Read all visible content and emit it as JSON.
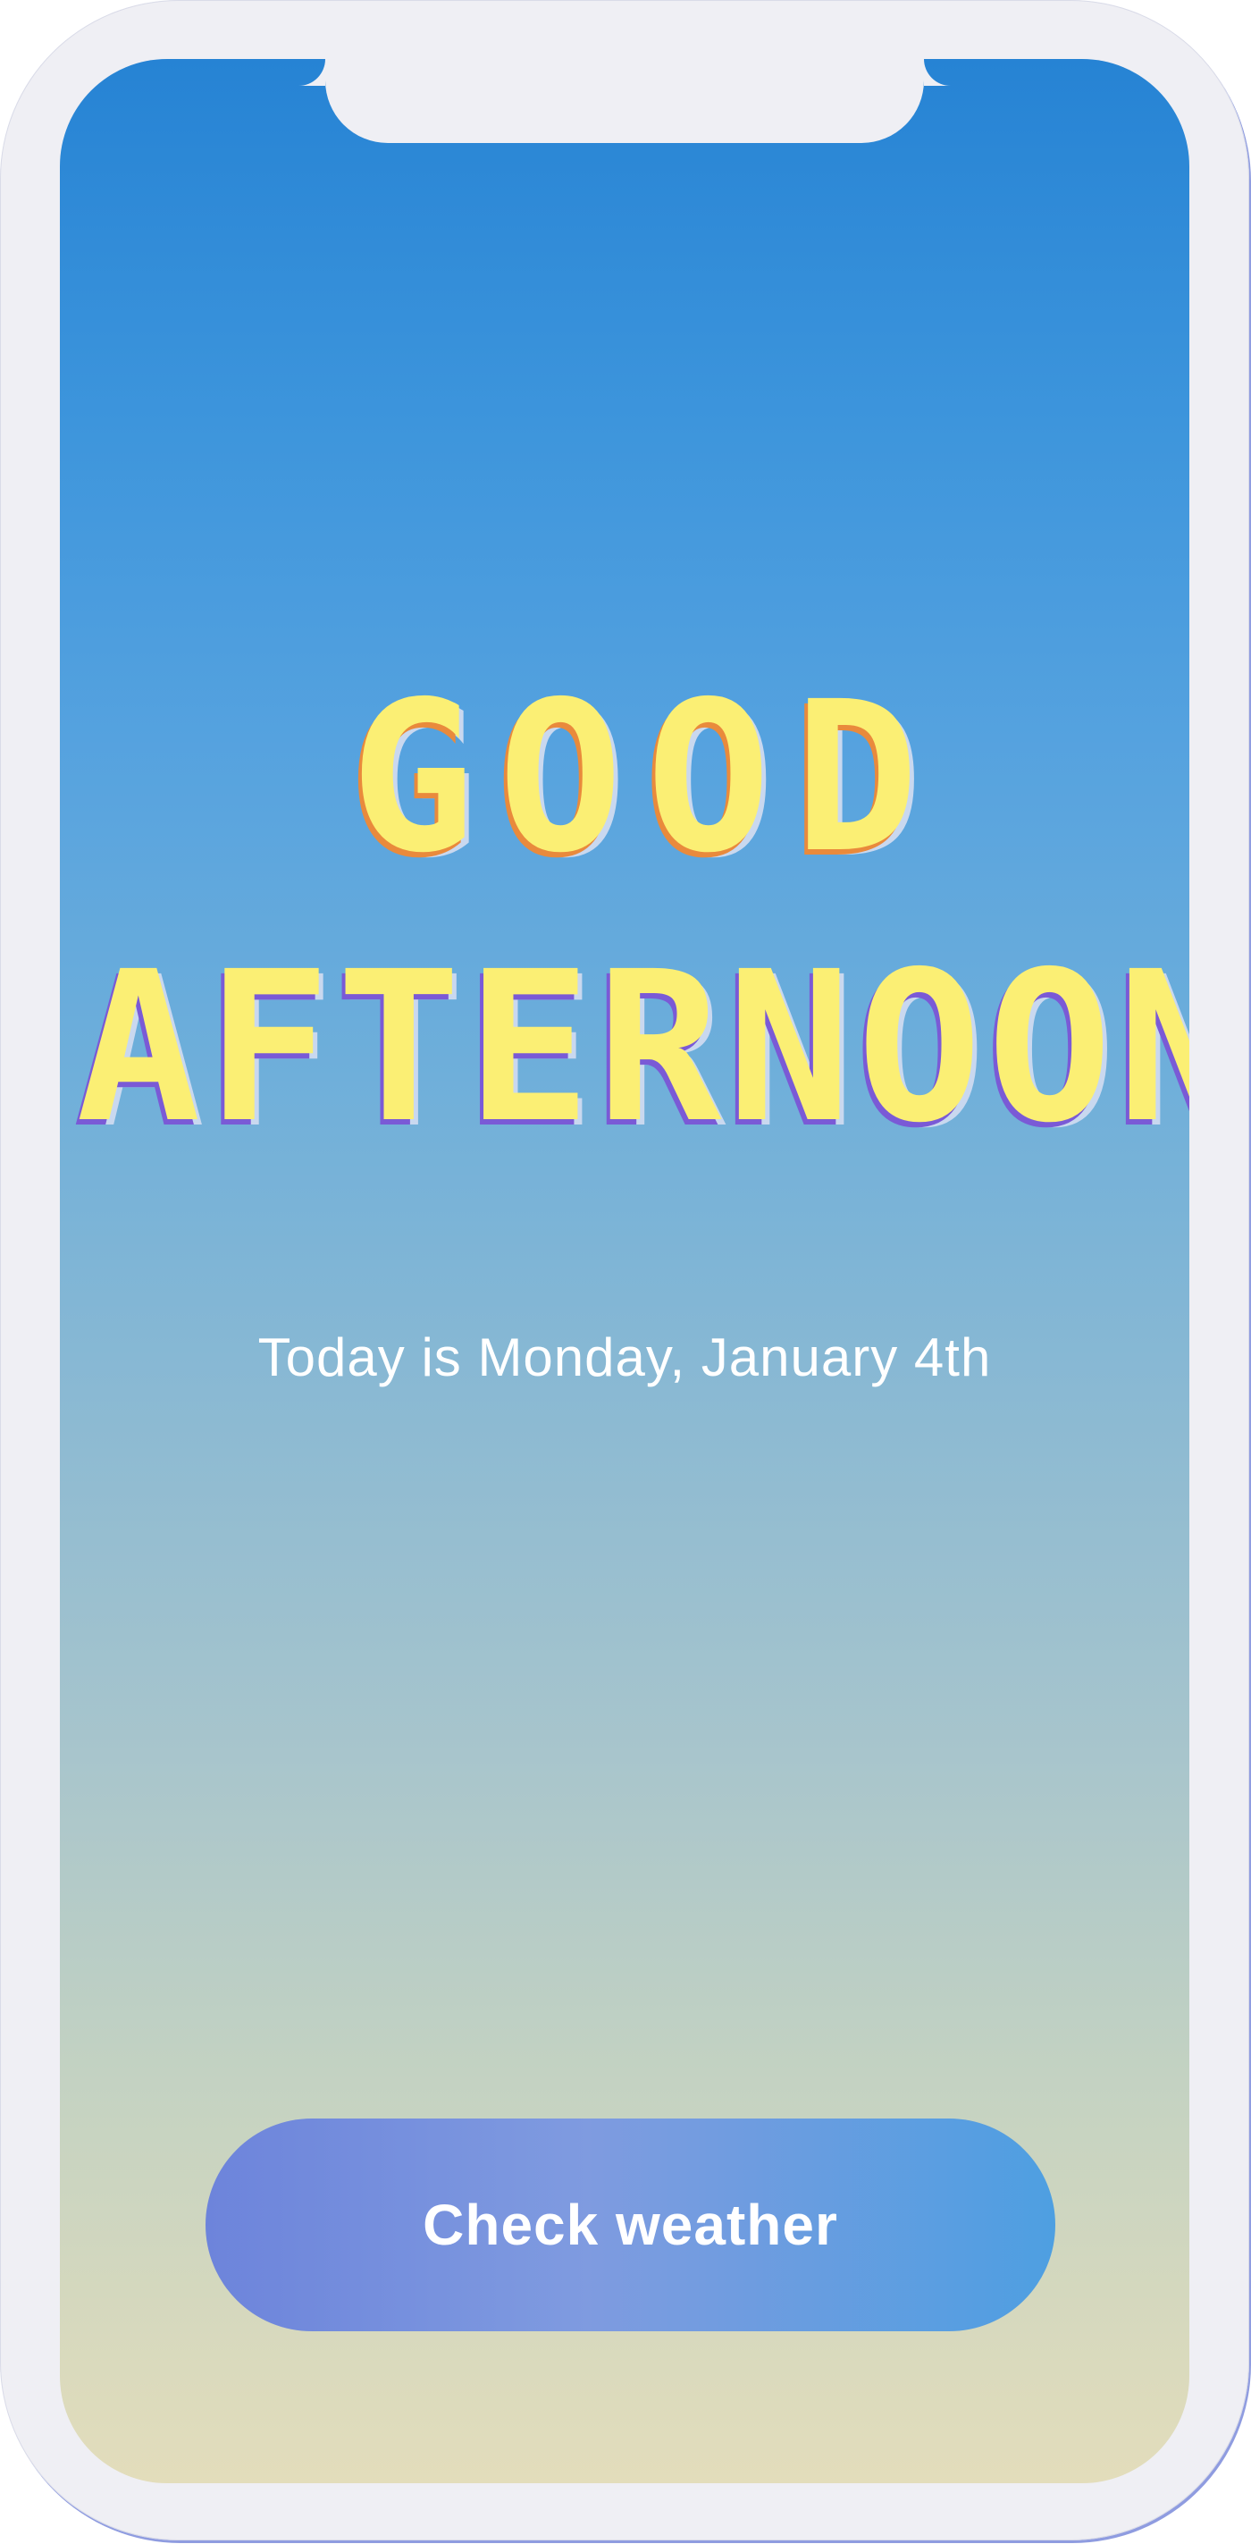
{
  "greeting": {
    "line1": "GOOD",
    "line2": "AFTERNOON"
  },
  "date_text": "Today is Monday, January 4th",
  "cta": {
    "label": "Check weather"
  },
  "colors": {
    "greeting_text": "#fbef74",
    "gradient_top": "#2683d4",
    "gradient_bottom": "#e3ddbb",
    "button_start": "#6d84db",
    "button_end": "#4e9fe1",
    "device_frame": "#efeff4"
  }
}
